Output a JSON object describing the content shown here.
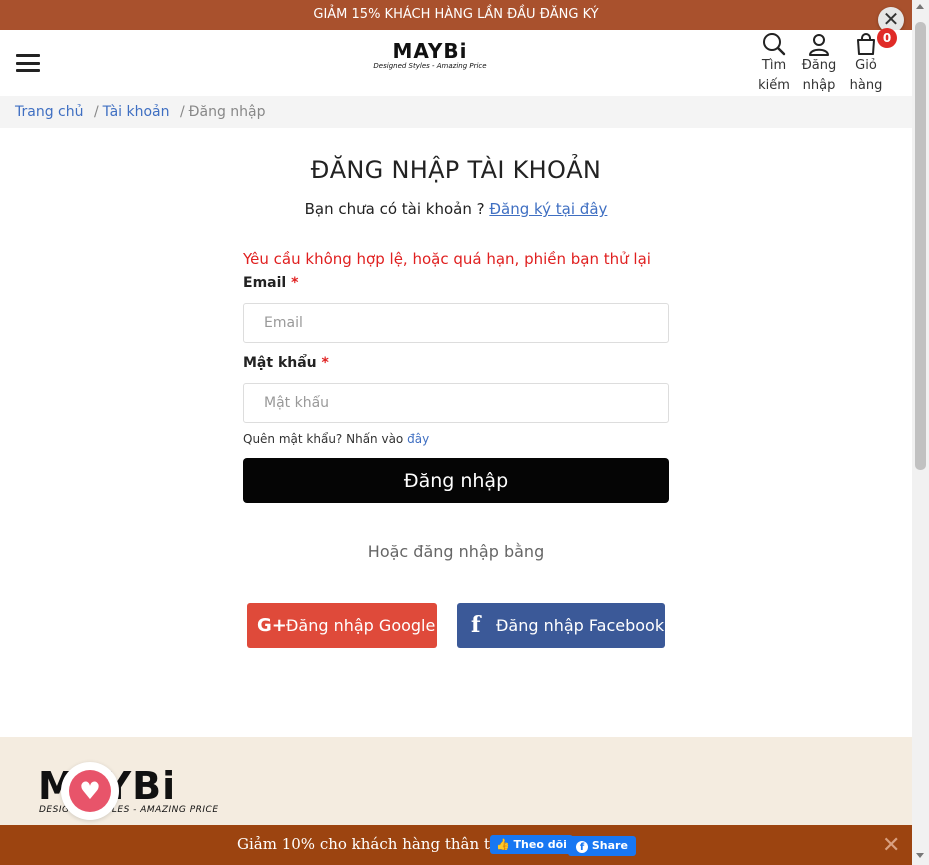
{
  "promo": {
    "text": "GIẢM 15% KHÁCH HÀNG LẦN ĐẦU ĐĂNG KÝ",
    "close": "✕"
  },
  "header": {
    "logo": "MAYBi",
    "logo_tagline": "Designed Styles - Amazing Price",
    "search": {
      "line1": "Tìm",
      "line2": "kiếm"
    },
    "account": {
      "line1": "Đăng",
      "line2": "nhập"
    },
    "cart": {
      "line1": "Giỏ",
      "line2": "hàng",
      "count": "0"
    }
  },
  "breadcrumb": {
    "home": "Trang chủ",
    "sep1": "/",
    "account": "Tài khoản",
    "sep2": "/",
    "current": "Đăng nhập"
  },
  "login": {
    "title": "ĐĂNG NHẬP TÀI KHOẢN",
    "no_account": "Bạn chưa có tài khoản ?",
    "register_link": "Đăng ký tại đây",
    "error": "Yêu cầu không hợp lệ, hoặc quá hạn, phiền bạn thử lại",
    "email_label": "Email",
    "email_placeholder": "Email",
    "email_value": "",
    "password_label": "Mật khẩu",
    "password_placeholder": "Mật khẩu",
    "password_value": "",
    "required_mark": "*",
    "forgot_text": "Quên mật khẩu? Nhấn vào",
    "forgot_link": "đây",
    "submit": "Đăng nhập",
    "or_text": "Hoặc đăng nhập bằng",
    "google": {
      "icon": "G+",
      "label": "Đăng nhập Google"
    },
    "facebook": {
      "icon": "f",
      "label": "Đăng nhập Facebook"
    }
  },
  "footer": {
    "logo": "MAYBi",
    "logo_tagline": "DESIGNED STYLES - AMAZING PRICE",
    "heart": "♥"
  },
  "bottom_bar": {
    "text": "Giảm 10% cho khách hàng thân thiết",
    "follow": "Theo dõi",
    "share": "Share",
    "close": "✕"
  },
  "colors": {
    "promo_bg": "#a9512d",
    "bottom_bar_bg": "#9c4410",
    "link": "#3f6fc2",
    "error": "#e02020",
    "google": "#df4a3a",
    "facebook": "#3b5998",
    "footer_bg": "#f4ece0"
  }
}
